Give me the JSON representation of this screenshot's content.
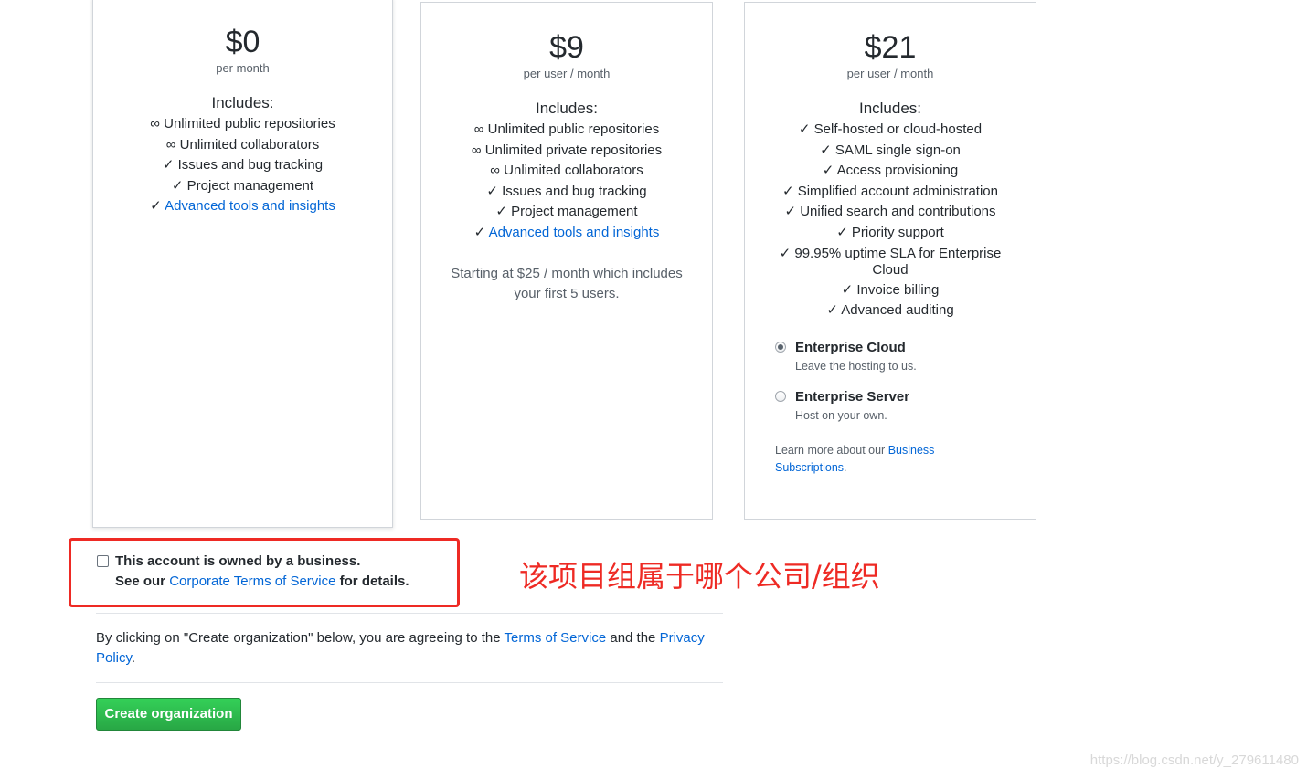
{
  "plans": {
    "free": {
      "price": "$0",
      "per": "per month",
      "includes": "Includes:",
      "features": [
        "∞ Unlimited public repositories",
        "∞ Unlimited collaborators",
        "✓ Issues and bug tracking",
        "✓ Project management"
      ],
      "link_mark": "✓",
      "link_feature": "Advanced tools and insights"
    },
    "team": {
      "price": "$9",
      "per": "per user / month",
      "includes": "Includes:",
      "features": [
        "∞ Unlimited public repositories",
        "∞ Unlimited private repositories",
        "∞ Unlimited collaborators",
        "✓ Issues and bug tracking",
        "✓ Project management"
      ],
      "link_mark": "✓",
      "link_feature": "Advanced tools and insights",
      "starting_note": "Starting at $25 / month which includes your first 5 users."
    },
    "enterprise": {
      "price": "$21",
      "per": "per user / month",
      "includes": "Includes:",
      "features": [
        "✓ Self-hosted or cloud-hosted",
        "✓ SAML single sign-on",
        "✓ Access provisioning",
        "✓ Simplified account administration",
        "✓ Unified search and contributions",
        "✓ Priority support",
        "✓ 99.95% uptime SLA for Enterprise Cloud",
        "✓ Invoice billing",
        "✓ Advanced auditing"
      ],
      "options": [
        {
          "title": "Enterprise Cloud",
          "desc": "Leave the hosting to us.",
          "checked": true
        },
        {
          "title": "Enterprise Server",
          "desc": "Host on your own.",
          "checked": false
        }
      ],
      "learn_prefix": "Learn more about our ",
      "learn_link": "Business Subscriptions",
      "learn_suffix": "."
    }
  },
  "business": {
    "checkbox_label": "This account is owned by a business.",
    "details_prefix": "See our ",
    "details_link": "Corporate Terms of Service",
    "details_suffix": " for details.",
    "checked": false
  },
  "annotation": "该项目组属于哪个公司/组织",
  "agreement": {
    "prefix": "By clicking on \"Create organization\" below, you are agreeing to the ",
    "tos_link": "Terms of Service",
    "middle": " and the ",
    "privacy_link": "Privacy Policy",
    "suffix": "."
  },
  "create_button": "Create organization",
  "watermark": "https://blog.csdn.net/y_279611480",
  "colors": {
    "link": "#0366d6",
    "annotation_red": "#ee2a24",
    "button_green": "#28a745"
  }
}
